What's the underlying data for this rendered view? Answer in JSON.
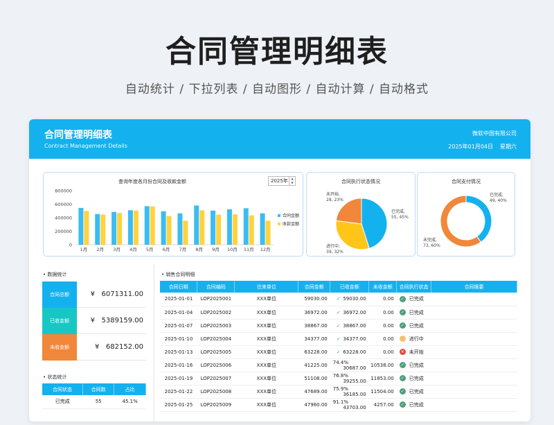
{
  "hero": {
    "title": "合同管理明细表",
    "features": "自动统计 / 下拉列表 / 自动图形 / 自动计算 / 自动格式"
  },
  "header": {
    "title": "合同管理明细表",
    "subtitle": "Contract Management Details",
    "company": "微软中国有限公司",
    "date": "2025年01月04日",
    "weekday": "星期六"
  },
  "bar_card": {
    "title": "查询年度各月份合同及收款金额",
    "year": "2025年"
  },
  "status_card": {
    "title": "合同执行状态情况"
  },
  "pay_card": {
    "title": "合同支付情况"
  },
  "colors": {
    "accent": "#14b1ef",
    "blue": "#3bbcf3",
    "yellow": "#ffd33d",
    "orange": "#f0873a",
    "teal": "#17c7c3"
  },
  "chart_data": [
    {
      "type": "bar",
      "title": "查询年度各月份合同及收款金额",
      "categories": [
        "1月",
        "2月",
        "3月",
        "4月",
        "5月",
        "6月",
        "7月",
        "8月",
        "9月",
        "10月",
        "11月",
        "12月"
      ],
      "ylim": [
        0,
        800000
      ],
      "yticks": [
        "0",
        "200000",
        "400000",
        "600000",
        "800000"
      ],
      "series": [
        {
          "name": "合同金额",
          "color": "#3bbcf3",
          "values": [
            545000,
            455000,
            485000,
            510000,
            570000,
            495000,
            465000,
            580000,
            505000,
            525000,
            540000,
            465000
          ]
        },
        {
          "name": "收款金额",
          "color": "#ffd33d",
          "values": [
            500000,
            445000,
            470000,
            505000,
            565000,
            425000,
            355000,
            510000,
            445000,
            450000,
            435000,
            355000
          ]
        }
      ],
      "legend": "right"
    },
    {
      "type": "pie",
      "title": "合同执行状态情况",
      "slices": [
        {
          "label": "已完成",
          "value": 55,
          "percent": "45%",
          "color": "#14b1ef"
        },
        {
          "label": "进行中",
          "value": 39,
          "percent": "32%",
          "color": "#ffc619"
        },
        {
          "label": "未开始",
          "value": 28,
          "percent": "23%",
          "color": "#f0873a"
        }
      ]
    },
    {
      "type": "pie",
      "title": "合同支付情况",
      "donut": true,
      "slices": [
        {
          "label": "已完成",
          "value": 49,
          "percent": "40%",
          "color": "#14b1ef"
        },
        {
          "label": "未完成",
          "value": 73,
          "percent": "60%",
          "color": "#f0873a"
        }
      ]
    }
  ],
  "data_stats": {
    "title": "• 数据统计",
    "rows": [
      {
        "label": "合同总额",
        "value": "¥   6071311.00",
        "color": "#14b1ef"
      },
      {
        "label": "已收金额",
        "value": "¥   5389159.00",
        "color": "#17c7c3"
      },
      {
        "label": "未收金额",
        "value": "¥   682152.00",
        "color": "#f0873a"
      }
    ]
  },
  "status_stats": {
    "title": "• 状态统计",
    "headers": [
      "合同状态",
      "合同数",
      "占比"
    ],
    "rows": [
      [
        "已完成",
        "55",
        "45.1%"
      ]
    ]
  },
  "detail": {
    "title": "• 销售合同明细",
    "headers": [
      "合同日期",
      "合同编码",
      "往来单位",
      "合同金额",
      "已收金额",
      "未收金额",
      "合同执行状态",
      "合同摘要"
    ],
    "rows": [
      {
        "date": "2025-01-01",
        "code": "LOP2025001",
        "unit": "XXX单位",
        "amount": "59030.00",
        "rate": "✓",
        "received": "59030.00",
        "unpaid": "0.00",
        "status": "已完成",
        "kind": "done"
      },
      {
        "date": "2025-01-04",
        "code": "LOP2025002",
        "unit": "XXX单位",
        "amount": "36972.00",
        "rate": "✓",
        "received": "36972.00",
        "unpaid": "0.00",
        "status": "已完成",
        "kind": "done"
      },
      {
        "date": "2025-01-07",
        "code": "LOP2025003",
        "unit": "XXX单位",
        "amount": "38867.00",
        "rate": "✓",
        "received": "38867.00",
        "unpaid": "0.00",
        "status": "已完成",
        "kind": "done"
      },
      {
        "date": "2025-01-10",
        "code": "LOP2025004",
        "unit": "XXX单位",
        "amount": "34377.00",
        "rate": "✓",
        "received": "34377.00",
        "unpaid": "0.00",
        "status": "进行中",
        "kind": "progress"
      },
      {
        "date": "2025-01-13",
        "code": "LOP2025005",
        "unit": "XXX单位",
        "amount": "63228.00",
        "rate": "✓",
        "received": "63228.00",
        "unpaid": "0.00",
        "status": "未开始",
        "kind": "notstarted"
      },
      {
        "date": "2025-01-16",
        "code": "LOP2025006",
        "unit": "XXX单位",
        "amount": "41225.00",
        "rate": "74.4%",
        "received": "30687.00",
        "unpaid": "10538.00",
        "status": "已完成",
        "kind": "done"
      },
      {
        "date": "2025-01-19",
        "code": "LOP2025007",
        "unit": "XXX单位",
        "amount": "51108.00",
        "rate": "76.8%",
        "received": "39255.00",
        "unpaid": "11853.00",
        "status": "已完成",
        "kind": "done"
      },
      {
        "date": "2025-01-22",
        "code": "LOP2025008",
        "unit": "XXX单位",
        "amount": "47689.00",
        "rate": "75.9%",
        "received": "36185.00",
        "unpaid": "11504.00",
        "status": "已完成",
        "kind": "done"
      },
      {
        "date": "2025-01-25",
        "code": "LOP2025009",
        "unit": "XXX单位",
        "amount": "47960.00",
        "rate": "91.1%",
        "received": "43703.00",
        "unpaid": "4257.00",
        "status": "已完成",
        "kind": "done"
      }
    ]
  }
}
